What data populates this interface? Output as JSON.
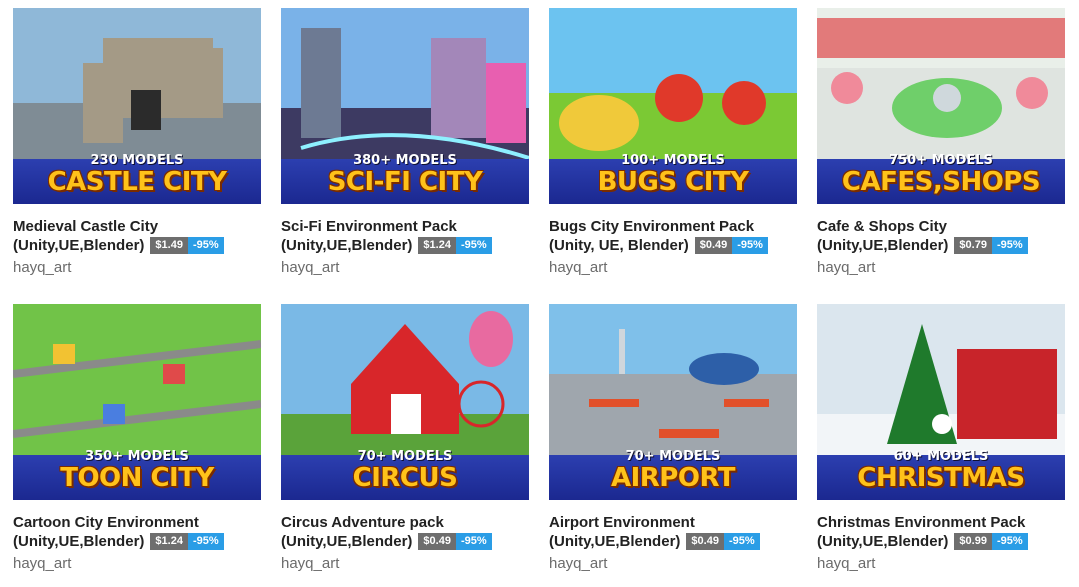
{
  "products": [
    {
      "title_line1": "Medieval Castle City",
      "title_line2": "(Unity,UE,Blender)",
      "price": "$1.49",
      "discount": "-95%",
      "author": "hayq_art",
      "banner_models": "230 MODELS",
      "banner_name": "CASTLE CITY",
      "theme_sky": "#8fb8d8",
      "theme_ground": "#7f8c95",
      "theme_accent": "#a49a86"
    },
    {
      "title_line1": "Sci-Fi Environment Pack",
      "title_line2": "(Unity,UE,Blender)",
      "price": "$1.24",
      "discount": "-95%",
      "author": "hayq_art",
      "banner_models": "380+ MODELS",
      "banner_name": "SCI-FI CITY",
      "theme_sky": "#7ab2e8",
      "theme_ground": "#3d3a62",
      "theme_accent": "#e85fb0"
    },
    {
      "title_line1": "Bugs City Environment Pack",
      "title_line2": "(Unity, UE, Blender)",
      "price": "$0.49",
      "discount": "-95%",
      "author": "hayq_art",
      "banner_models": "100+ MODELS",
      "banner_name": "BUGS CITY",
      "theme_sky": "#6cc3f0",
      "theme_ground": "#7bc934",
      "theme_accent": "#e0392a"
    },
    {
      "title_line1": "Cafe & Shops City",
      "title_line2": "(Unity,UE,Blender)",
      "price": "$0.79",
      "discount": "-95%",
      "author": "hayq_art",
      "banner_models": "750+ MODELS",
      "banner_name": "CAFES,SHOPS",
      "theme_sky": "#e9efe9",
      "theme_ground": "#dfe4e0",
      "theme_accent": "#f08a9a"
    },
    {
      "title_line1": "Cartoon City Environment",
      "title_line2": "(Unity,UE,Blender)",
      "price": "$1.24",
      "discount": "-95%",
      "author": "hayq_art",
      "banner_models": "350+ MODELS",
      "banner_name": "TOON CITY",
      "theme_sky": "#8fcf5a",
      "theme_ground": "#5dbb3c",
      "theme_accent": "#f2c232"
    },
    {
      "title_line1": "Circus Adventure pack",
      "title_line2": "(Unity,UE,Blender)",
      "price": "$0.49",
      "discount": "-95%",
      "author": "hayq_art",
      "banner_models": "70+ MODELS",
      "banner_name": "CIRCUS",
      "theme_sky": "#7ab9e6",
      "theme_ground": "#5aa33a",
      "theme_accent": "#d8262a"
    },
    {
      "title_line1": "Airport Environment",
      "title_line2": "(Unity,UE,Blender)",
      "price": "$0.49",
      "discount": "-95%",
      "author": "hayq_art",
      "banner_models": "70+ MODELS",
      "banner_name": "AIRPORT",
      "theme_sky": "#7fc0ea",
      "theme_ground": "#9fa6ad",
      "theme_accent": "#e2502a"
    },
    {
      "title_line1": "Christmas Environment Pack",
      "title_line2": "(Unity,UE,Blender)",
      "price": "$0.99",
      "discount": "-95%",
      "author": "hayq_art",
      "banner_models": "60+ MODELS",
      "banner_name": "CHRISTMAS",
      "theme_sky": "#dbe6ee",
      "theme_ground": "#f2f5f8",
      "theme_accent": "#c8242a"
    }
  ]
}
